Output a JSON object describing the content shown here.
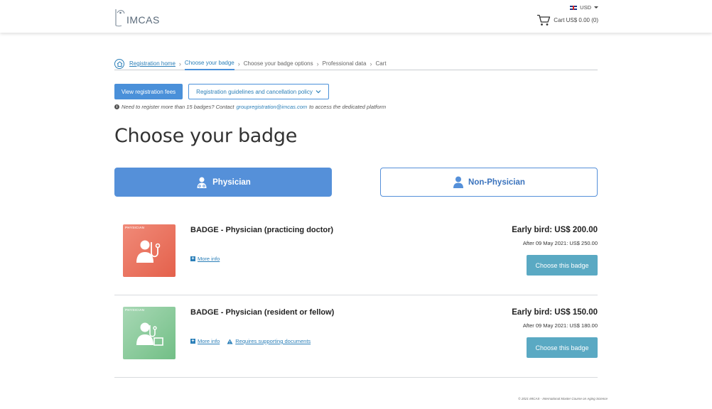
{
  "header": {
    "logo_text": "IMCAS",
    "currency": "USD",
    "cart_label": "Cart US$ 0.00 (0)"
  },
  "breadcrumb": {
    "items": [
      "Registration home",
      "Choose your badge",
      "Choose your badge options",
      "Professional data",
      "Cart"
    ]
  },
  "actions": {
    "fees_label": "View registration fees",
    "guidelines_label": "Registration guidelines and cancellation policy"
  },
  "notice": {
    "prefix": "Need to register more than 15 badges? Contact ",
    "email": "groupregistration@imcas.com",
    "suffix": " to access the dedicated platform"
  },
  "page_title": "Choose your badge",
  "tabs": [
    {
      "label": "Physician",
      "active": true
    },
    {
      "label": "Non-Physician",
      "active": false
    }
  ],
  "badges": [
    {
      "thumb_label": "PHYSICIAN",
      "name": "BADGE - Physician (practicing doctor)",
      "more_info": "More info",
      "price": "Early bird: US$ 200.00",
      "after": "After 09 May 2021: US$ 250.00",
      "button": "Choose this badge",
      "color": "#e4614c"
    },
    {
      "thumb_label": "PHYSICIAN",
      "name": "BADGE - Physician (resident or fellow)",
      "more_info": "More info",
      "docs": "Requires supporting documents",
      "price": "Early bird: US$ 150.00",
      "after": "After 09 May 2021: US$ 180.00",
      "button": "Choose this badge",
      "color": "#72bf86"
    }
  ],
  "footer": "© 2021 IMCAS - International Master Course on Aging Science",
  "colors": {
    "primary": "#4a90d9",
    "teal_button": "#5aa9c3",
    "link": "#2b7fb8"
  }
}
